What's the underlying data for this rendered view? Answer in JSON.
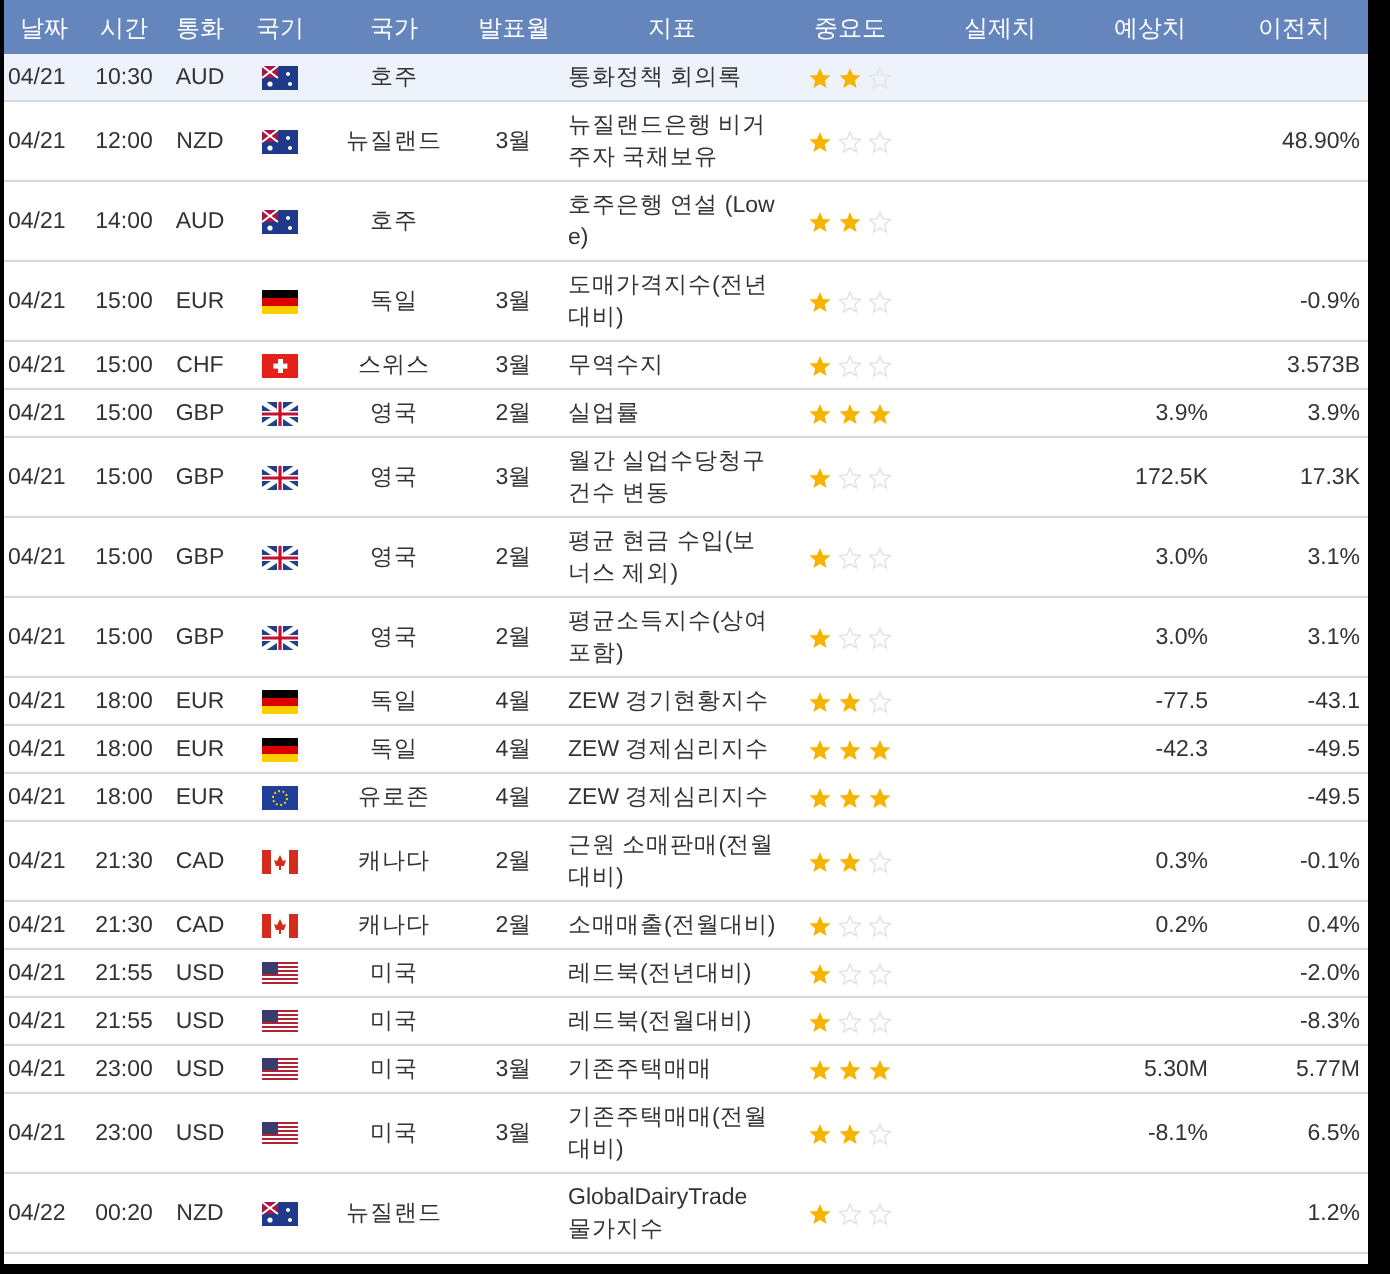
{
  "columns": [
    "날짜",
    "시간",
    "통화",
    "국기",
    "국가",
    "발표월",
    "지표",
    "중요도",
    "실제치",
    "예상치",
    "이전치"
  ],
  "rows": [
    {
      "date": "04/21",
      "time": "10:30",
      "currency": "AUD",
      "kind": "au",
      "country": "호주",
      "month": "",
      "indicator": "통화정책 회의록",
      "stars": 2,
      "actual": "",
      "forecast": "",
      "previous": "",
      "selected": true
    },
    {
      "date": "04/21",
      "time": "12:00",
      "currency": "NZD",
      "kind": "au",
      "country": "뉴질랜드",
      "month": "3월",
      "indicator": "뉴질랜드은행 비거주자 국채보유",
      "stars": 1,
      "actual": "",
      "forecast": "",
      "previous": "48.90%",
      "selected": false
    },
    {
      "date": "04/21",
      "time": "14:00",
      "currency": "AUD",
      "kind": "au",
      "country": "호주",
      "month": "",
      "indicator": "호주은행 연설 (Lowe)",
      "stars": 2,
      "actual": "",
      "forecast": "",
      "previous": "",
      "selected": false
    },
    {
      "date": "04/21",
      "time": "15:00",
      "currency": "EUR",
      "kind": "de",
      "country": "독일",
      "month": "3월",
      "indicator": "도매가격지수(전년대비)",
      "stars": 1,
      "actual": "",
      "forecast": "",
      "previous": "-0.9%",
      "selected": false
    },
    {
      "date": "04/21",
      "time": "15:00",
      "currency": "CHF",
      "kind": "ch",
      "country": "스위스",
      "month": "3월",
      "indicator": "무역수지",
      "stars": 1,
      "actual": "",
      "forecast": "",
      "previous": "3.573B",
      "selected": false
    },
    {
      "date": "04/21",
      "time": "15:00",
      "currency": "GBP",
      "kind": "gb",
      "country": "영국",
      "month": "2월",
      "indicator": "실업률",
      "stars": 3,
      "actual": "",
      "forecast": "3.9%",
      "previous": "3.9%",
      "selected": false
    },
    {
      "date": "04/21",
      "time": "15:00",
      "currency": "GBP",
      "kind": "gb",
      "country": "영국",
      "month": "3월",
      "indicator": "월간 실업수당청구건수 변동",
      "stars": 1,
      "actual": "",
      "forecast": "172.5K",
      "previous": "17.3K",
      "selected": false
    },
    {
      "date": "04/21",
      "time": "15:00",
      "currency": "GBP",
      "kind": "gb",
      "country": "영국",
      "month": "2월",
      "indicator": "평균 현금 수입(보너스 제외)",
      "stars": 1,
      "actual": "",
      "forecast": "3.0%",
      "previous": "3.1%",
      "selected": false
    },
    {
      "date": "04/21",
      "time": "15:00",
      "currency": "GBP",
      "kind": "gb",
      "country": "영국",
      "month": "2월",
      "indicator": "평균소득지수(상여포함)",
      "stars": 1,
      "actual": "",
      "forecast": "3.0%",
      "previous": "3.1%",
      "selected": false
    },
    {
      "date": "04/21",
      "time": "18:00",
      "currency": "EUR",
      "kind": "de",
      "country": "독일",
      "month": "4월",
      "indicator": "ZEW 경기현황지수",
      "stars": 2,
      "actual": "",
      "forecast": "-77.5",
      "previous": "-43.1",
      "selected": false
    },
    {
      "date": "04/21",
      "time": "18:00",
      "currency": "EUR",
      "kind": "de",
      "country": "독일",
      "month": "4월",
      "indicator": "ZEW 경제심리지수",
      "stars": 3,
      "actual": "",
      "forecast": "-42.3",
      "previous": "-49.5",
      "selected": false
    },
    {
      "date": "04/21",
      "time": "18:00",
      "currency": "EUR",
      "kind": "eu",
      "country": "유로존",
      "month": "4월",
      "indicator": "ZEW 경제심리지수",
      "stars": 3,
      "actual": "",
      "forecast": "",
      "previous": "-49.5",
      "selected": false
    },
    {
      "date": "04/21",
      "time": "21:30",
      "currency": "CAD",
      "kind": "ca",
      "country": "캐나다",
      "month": "2월",
      "indicator": "근원 소매판매(전월대비)",
      "stars": 2,
      "actual": "",
      "forecast": "0.3%",
      "previous": "-0.1%",
      "selected": false
    },
    {
      "date": "04/21",
      "time": "21:30",
      "currency": "CAD",
      "kind": "ca",
      "country": "캐나다",
      "month": "2월",
      "indicator": "소매매출(전월대비)",
      "stars": 1,
      "actual": "",
      "forecast": "0.2%",
      "previous": "0.4%",
      "selected": false
    },
    {
      "date": "04/21",
      "time": "21:55",
      "currency": "USD",
      "kind": "us",
      "country": "미국",
      "month": "",
      "indicator": "레드북(전년대비)",
      "stars": 1,
      "actual": "",
      "forecast": "",
      "previous": "-2.0%",
      "selected": false
    },
    {
      "date": "04/21",
      "time": "21:55",
      "currency": "USD",
      "kind": "us",
      "country": "미국",
      "month": "",
      "indicator": "레드북(전월대비)",
      "stars": 1,
      "actual": "",
      "forecast": "",
      "previous": "-8.3%",
      "selected": false
    },
    {
      "date": "04/21",
      "time": "23:00",
      "currency": "USD",
      "kind": "us",
      "country": "미국",
      "month": "3월",
      "indicator": "기존주택매매",
      "stars": 3,
      "actual": "",
      "forecast": "5.30M",
      "previous": "5.77M",
      "selected": false
    },
    {
      "date": "04/21",
      "time": "23:00",
      "currency": "USD",
      "kind": "us",
      "country": "미국",
      "month": "3월",
      "indicator": "기존주택매매(전월대비)",
      "stars": 2,
      "actual": "",
      "forecast": "-8.1%",
      "previous": "6.5%",
      "selected": false
    },
    {
      "date": "04/22",
      "time": "00:20",
      "currency": "NZD",
      "kind": "au",
      "country": "뉴질랜드",
      "month": "",
      "indicator": "GlobalDairyTrade 물가지수",
      "stars": 1,
      "actual": "",
      "forecast": "",
      "previous": "1.2%",
      "selected": false
    }
  ]
}
